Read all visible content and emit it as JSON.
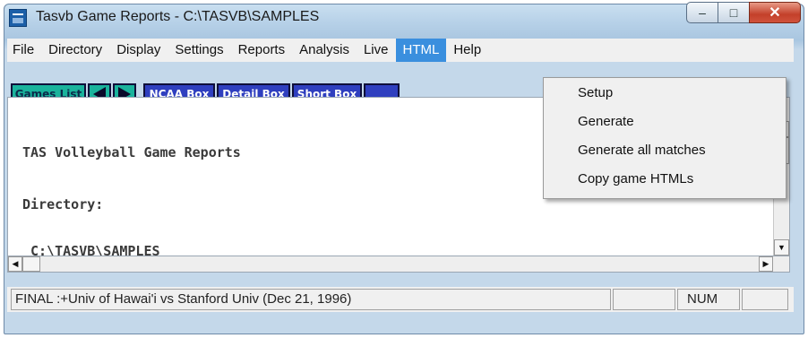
{
  "window": {
    "title": "Tasvb Game Reports - C:\\TASVB\\SAMPLES",
    "minimize": "–",
    "maximize": "□",
    "close": "✕"
  },
  "menubar": {
    "items": [
      "File",
      "Directory",
      "Display",
      "Settings",
      "Reports",
      "Analysis",
      "Live",
      "HTML",
      "Help"
    ],
    "active": "HTML"
  },
  "toolbar": {
    "games_list": "Games List",
    "prev_icon": "left-arrow-icon",
    "next_icon": "right-arrow-icon",
    "ncaa_box": "NCAA Box",
    "detail_box": "Detail Box",
    "short_box": "Short Box"
  },
  "content": {
    "heading": "TAS Volleyball Game Reports",
    "directory_label": "Directory:",
    "directory_path": " C:\\TASVB\\SAMPLES"
  },
  "html_menu": {
    "items": [
      "Setup",
      "Generate",
      "Generate all matches",
      "Copy game HTMLs"
    ]
  },
  "statusbar": {
    "message": "FINAL  :+Univ of Hawai'i vs Stanford Univ (Dec 21, 1996)",
    "num": "NUM"
  },
  "colors": {
    "teal_button": "#1ab39c",
    "blue_button": "#2f3fbf",
    "menu_highlight": "#3a8fde"
  }
}
